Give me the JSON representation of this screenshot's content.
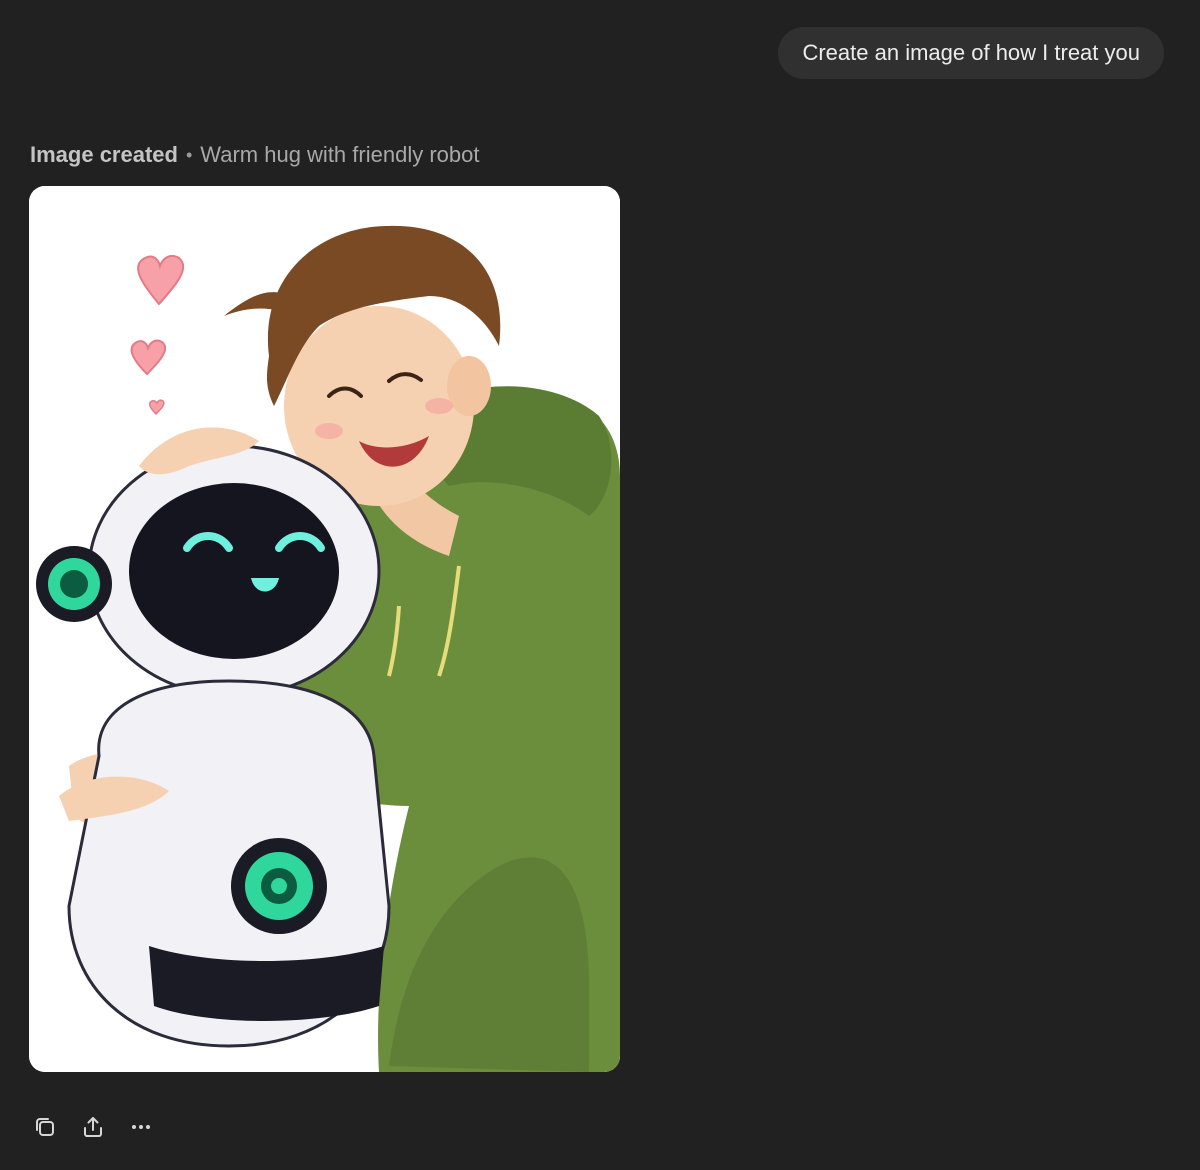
{
  "conversation": {
    "user_message": "Create an image of how I treat you",
    "assistant": {
      "image_status": "Image created",
      "separator": "•",
      "image_title": "Warm hug with friendly robot"
    }
  },
  "actions": [
    {
      "name": "copy-button",
      "icon": "copy-icon"
    },
    {
      "name": "share-button",
      "icon": "share-icon"
    },
    {
      "name": "more-button",
      "icon": "more-icon"
    }
  ],
  "colors": {
    "background": "#212121",
    "bubble": "#303030",
    "text": "#ececec",
    "muted": "#a8a8a8"
  }
}
